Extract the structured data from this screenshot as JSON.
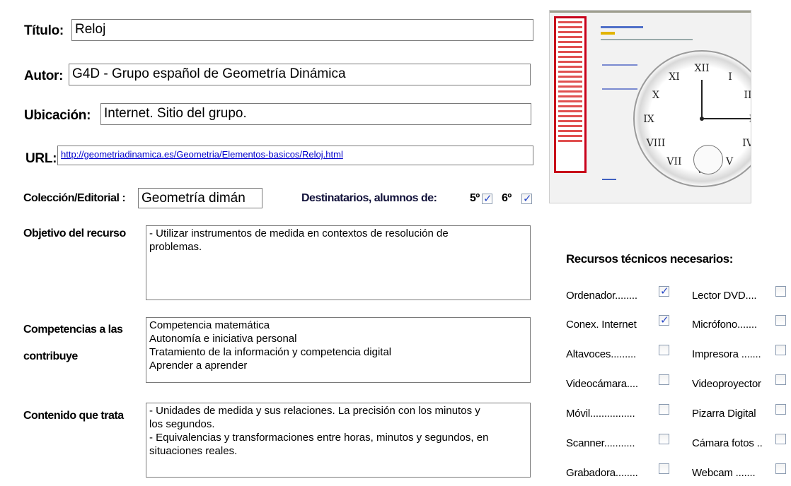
{
  "form": {
    "titulo_label": "Título:",
    "titulo_value": "Reloj",
    "autor_label": "Autor:",
    "autor_value": "G4D - Grupo español de Geometría Dinámica",
    "ubicacion_label": "Ubicación:",
    "ubicacion_value": "Internet. Sitio del grupo.",
    "url_label": "URL:",
    "url_value": "http://geometriadinamica.es/Geometria/Elementos-basicos/Reloj.html",
    "coleccion_label": "Colección/Editorial :",
    "coleccion_value": "Geometría dimán",
    "destinatarios_label": "Destinatarios, alumnos de:",
    "grade5_label": "5º",
    "grade6_label": "6º",
    "objetivo_label": "Objetivo del recurso",
    "objetivo_lines": [
      "- Utilizar instrumentos de medida en contextos de resolución de",
      "problemas."
    ],
    "competencias_label_1": "Competencias a las",
    "competencias_label_2": "contribuye",
    "competencias_lines": [
      "Competencia matemática",
      "Autonomía e iniciativa personal",
      "Tratamiento de la información y competencia digital",
      "Aprender a aprender"
    ],
    "contenido_label": "Contenido que trata",
    "contenido_lines": [
      "- Unidades de medida y sus relaciones. La precisión con los minutos y",
      "los segundos.",
      "- Equivalencias y transformaciones entre horas, minutos y segundos, en",
      "situaciones reales."
    ]
  },
  "recursos": {
    "title": "Recursos técnicos necesarios:",
    "left": [
      {
        "label": "Ordenador........",
        "checked": true
      },
      {
        "label": "Conex. Internet",
        "checked": true
      },
      {
        "label": "Altavoces.........",
        "checked": false
      },
      {
        "label": "Videocámara....",
        "checked": false
      },
      {
        "label": "Móvil................",
        "checked": false
      },
      {
        "label": "Scanner...........",
        "checked": false
      },
      {
        "label": "Grabadora........",
        "checked": false
      }
    ],
    "right": [
      {
        "label": "Lector DVD....",
        "checked": false
      },
      {
        "label": "Micrófono.......",
        "checked": false
      },
      {
        "label": "Impresora .......",
        "checked": false
      },
      {
        "label": "Videoproyector",
        "checked": false
      },
      {
        "label": "Pizarra Digital",
        "checked": false
      },
      {
        "label": "Cámara fotos ..",
        "checked": false
      },
      {
        "label": "Webcam .......",
        "checked": false
      }
    ]
  }
}
